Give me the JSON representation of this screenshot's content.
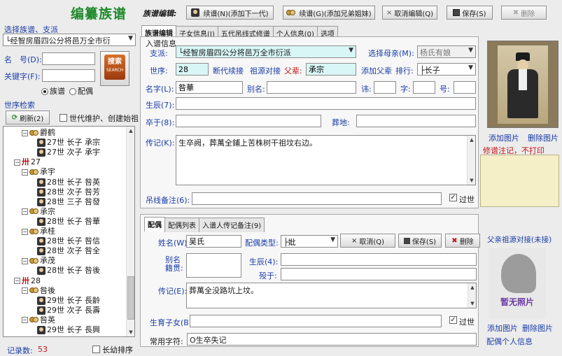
{
  "app": {
    "title": "编纂族谱"
  },
  "toolbar": {
    "section_label": "族谱编辑:",
    "btn_next_gen": "续谱(N)(添加下一代)",
    "btn_sibling": "续谱(G)(添加兄弟姐妹)",
    "btn_cancel": "取消编辑(Q)",
    "btn_save": "保存(S)",
    "btn_delete": "删除"
  },
  "left": {
    "branch_label": "选择族谱、支派",
    "branch_value": "└经智房眉四公分将邑万全市衍",
    "name_label": "名　号(D):",
    "keyword_label": "关键字(F):",
    "search_label": "搜索",
    "search_sub": "SEARCH",
    "radio_clan": "族谱",
    "radio_spouse": "配偶",
    "tree_label": "世序检索",
    "refresh_label": "刷新(2)",
    "maint_label": "世代维护、创建始祖",
    "record_label": "记录数:",
    "record_count": "53",
    "sort_label": "长幼排序",
    "tree": [
      {
        "type": "branch",
        "indent": 2,
        "text": "爵鹤"
      },
      {
        "type": "leaf",
        "indent": 4,
        "text": "27世 长子 承宗"
      },
      {
        "type": "leaf",
        "indent": 4,
        "text": "27世 次子 承宇"
      },
      {
        "type": "gen",
        "indent": 1,
        "text": "27"
      },
      {
        "type": "branch",
        "indent": 2,
        "text": "承宇"
      },
      {
        "type": "leaf",
        "indent": 4,
        "text": "28世 长子 咎英"
      },
      {
        "type": "leaf",
        "indent": 4,
        "text": "28世 次子 咎芳"
      },
      {
        "type": "leaf",
        "indent": 4,
        "text": "28世 三子 咎發"
      },
      {
        "type": "branch",
        "indent": 2,
        "text": "承宗"
      },
      {
        "type": "leaf",
        "indent": 4,
        "text": "28世 长子 咎華"
      },
      {
        "type": "branch",
        "indent": 2,
        "text": "承桂"
      },
      {
        "type": "leaf",
        "indent": 4,
        "text": "28世 长子 咎信"
      },
      {
        "type": "leaf",
        "indent": 4,
        "text": "28世 次子 咎全"
      },
      {
        "type": "branch",
        "indent": 2,
        "text": "承茂"
      },
      {
        "type": "leaf",
        "indent": 4,
        "text": "28世 长子 咎後"
      },
      {
        "type": "gen",
        "indent": 1,
        "text": "28"
      },
      {
        "type": "branch",
        "indent": 2,
        "text": "咎後"
      },
      {
        "type": "leaf",
        "indent": 4,
        "text": "29世 长子 長齡"
      },
      {
        "type": "leaf",
        "indent": 4,
        "text": "29世 次子 長壽"
      },
      {
        "type": "branch",
        "indent": 2,
        "text": "咎英"
      },
      {
        "type": "leaf",
        "indent": 4,
        "text": "29世 长子 長興"
      }
    ]
  },
  "tabs": [
    "族谱编辑",
    "子女信息(I)",
    "五代吊线式修谱",
    "个人信息(0)",
    "选项"
  ],
  "form": {
    "group_label": "入谱信息",
    "branch_label": "支派:",
    "branch_value": "└经智房眉四公分将邑万全市衍派",
    "mother_label": "选择母亲(M):",
    "mother_value": "杨氏有娘",
    "gen_label": "世序:",
    "gen_value": "28",
    "link_break": "断代续接",
    "link_source": "祖源对接",
    "father_label": "父辈:",
    "father_value": "承宗",
    "link_add_father": "添加父辈",
    "rank_label": "排行:",
    "rank_value": "├长子",
    "name_label": "名字(L):",
    "name_value": "咎華",
    "alias_label": "别名:",
    "taboo_label": "讳:",
    "courtesy_label": "字:",
    "title_label": "号:",
    "birth_label": "生辰(7):",
    "death_label": "卒于(8):",
    "burial_label": "葬地:",
    "bio_label": "传记(K):",
    "bio_value": "生卒阙，葬萬全鋪上苦株树干祖坟右边。",
    "line_note_label": "吊线备注(6):",
    "deceased_label": "过世",
    "photo_add": "添加图片",
    "photo_delete": "删除图片",
    "note_label": "修谱注记，不打印"
  },
  "spouse": {
    "tabs": [
      "配偶",
      "配偶列表",
      "入谱人传记备注(9)"
    ],
    "name_label": "姓名(W):",
    "name_value": "吴氏",
    "type_label": "配偶类型:",
    "type_value": "├妣",
    "btn_cancel": "取消(Q)",
    "btn_save": "保存(S)",
    "btn_delete": "删除",
    "alias_label": "别名\n籍贯:",
    "birth_label": "生辰(4):",
    "death_label": "殁于:",
    "bio_label": "传记(E):",
    "bio_value": "葬萬全没路坑上坟。",
    "children_label": "生育子女(B)",
    "deceased_label": "过世",
    "common_label": "常用字符:",
    "common_value": "O生卒失记",
    "source_link": "父亲祖源对接(未接)",
    "no_photo": "暂无照片",
    "photo_add": "添加图片",
    "photo_delete": "删除图片",
    "personal_info": "配偶个人信息"
  },
  "colors": {
    "title_green": "#1f8a2a",
    "label_blue": "#1a3ca8",
    "warn_red": "#c41414",
    "note_yellow": "#f5efc8"
  }
}
